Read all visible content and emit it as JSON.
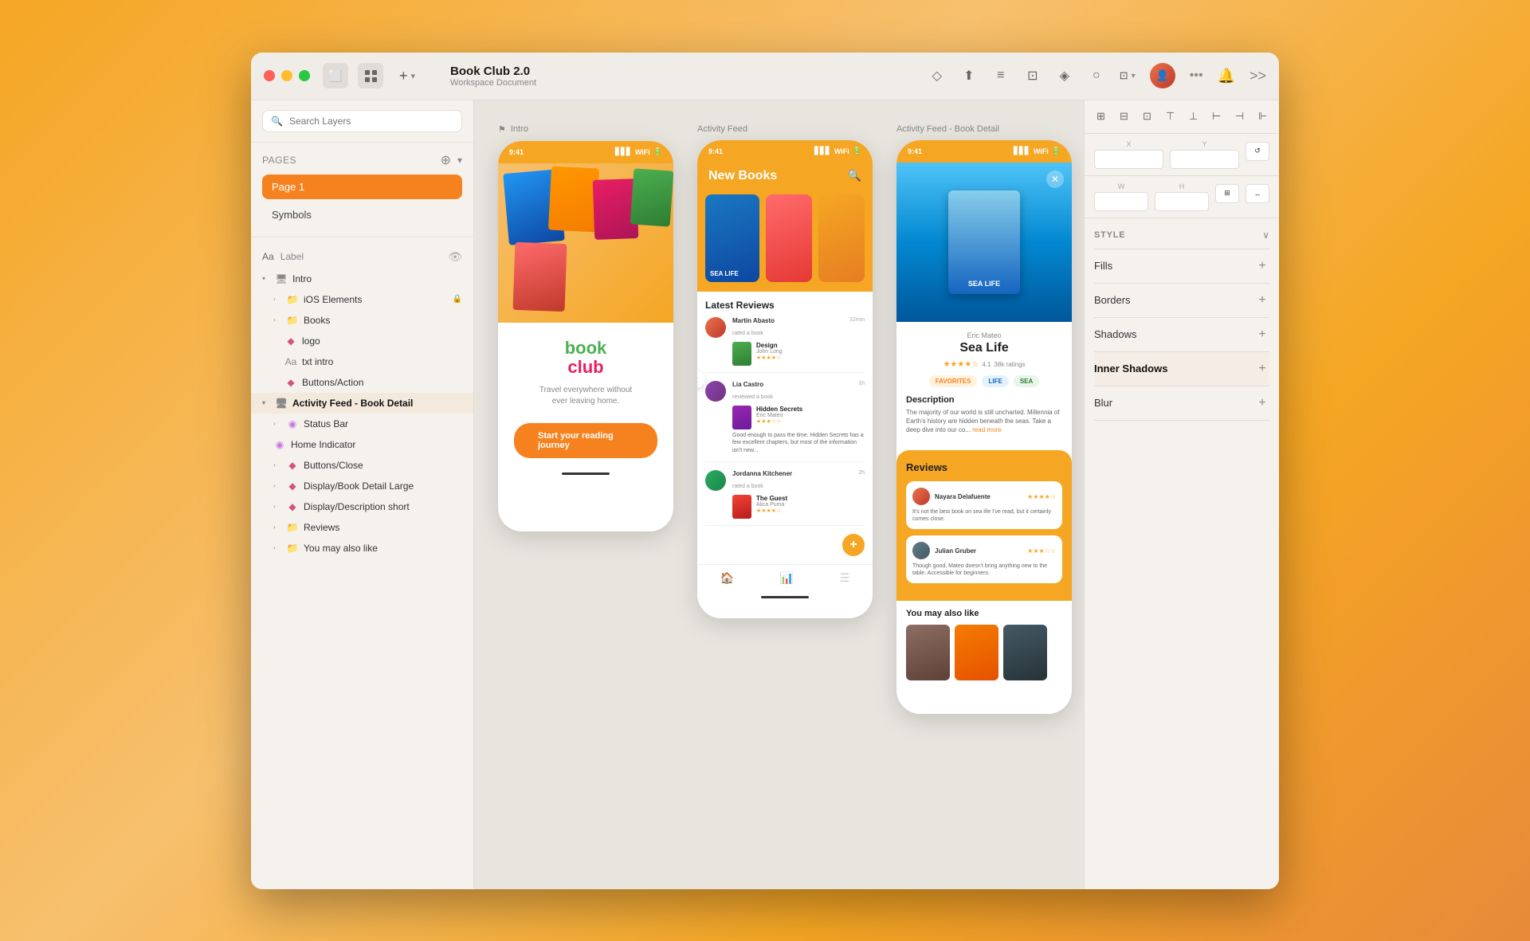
{
  "window": {
    "title": "Book Club 2.0",
    "subtitle": "Workspace Document"
  },
  "titlebar": {
    "add_label": "+",
    "actions": [
      {
        "icon": "diamond-icon",
        "label": "◇"
      },
      {
        "icon": "upload-icon",
        "label": "↑"
      },
      {
        "icon": "layers-icon",
        "label": "≡"
      },
      {
        "icon": "crop-icon",
        "label": "⊡"
      },
      {
        "icon": "component-icon",
        "label": "⊕"
      },
      {
        "icon": "mask-icon",
        "label": "○"
      }
    ]
  },
  "search": {
    "placeholder": "Search Layers"
  },
  "pages": {
    "label": "Pages",
    "items": [
      {
        "label": "Page 1",
        "active": true
      },
      {
        "label": "Symbols",
        "active": false
      }
    ]
  },
  "layers": {
    "label_text": "Label",
    "groups": [
      {
        "name": "Intro",
        "icon": "monitor-icon",
        "expanded": true,
        "indent": 0,
        "children": [
          {
            "name": "iOS Elements",
            "icon": "folder-icon",
            "indent": 1,
            "locked": true
          },
          {
            "name": "Books",
            "icon": "folder-icon",
            "indent": 1
          },
          {
            "name": "logo",
            "icon": "diamond-icon",
            "indent": 2
          },
          {
            "name": "txt intro",
            "icon": "text-icon",
            "indent": 2
          },
          {
            "name": "Buttons/Action",
            "icon": "diamond-icon",
            "indent": 2
          }
        ]
      },
      {
        "name": "Activity Feed - Book Detail",
        "icon": "monitor-icon",
        "expanded": true,
        "indent": 0,
        "active": true,
        "children": [
          {
            "name": "Status Bar",
            "icon": "component-icon",
            "indent": 1
          },
          {
            "name": "Home Indicator",
            "icon": "component-icon",
            "indent": 1
          },
          {
            "name": "Buttons/Close",
            "icon": "diamond-icon",
            "indent": 1
          },
          {
            "name": "Display/Book Detail Large",
            "icon": "diamond-icon",
            "indent": 1
          },
          {
            "name": "Display/Description short",
            "icon": "diamond-icon",
            "indent": 1
          },
          {
            "name": "Reviews",
            "icon": "folder-icon",
            "indent": 1
          },
          {
            "name": "You may also like",
            "icon": "folder-icon",
            "indent": 1
          }
        ]
      }
    ]
  },
  "canvas": {
    "frames": [
      {
        "label": "Intro",
        "type": "intro"
      },
      {
        "label": "Activity Feed",
        "type": "activity"
      },
      {
        "label": "Activity Feed - Book Detail",
        "type": "detail"
      }
    ]
  },
  "right_panel": {
    "style_label": "STYLE",
    "chevron": "∨",
    "rows": [
      {
        "label": "Fills",
        "plus": "+"
      },
      {
        "label": "Borders",
        "plus": "+"
      },
      {
        "label": "Shadows",
        "plus": "+"
      },
      {
        "label": "Inner Shadows",
        "plus": "+",
        "active": true
      },
      {
        "label": "Blur",
        "plus": "+"
      }
    ],
    "coords": {
      "x_label": "X",
      "y_label": "Y",
      "w_label": "W",
      "h_label": "H",
      "x_val": "",
      "y_val": "",
      "w_val": "",
      "h_val": ""
    }
  },
  "intro_screen": {
    "tagline_1": "Travel everywhere without",
    "tagline_2": "ever leaving home.",
    "cta": "Start your reading journey",
    "logo_book": "book",
    "logo_club": "club",
    "time": "9:41"
  },
  "activity_screen": {
    "time": "9:41",
    "title": "New Books",
    "section": "Latest Reviews",
    "reviews": [
      {
        "reviewer": "Martin Abasto",
        "action": "rated a book",
        "time": "32min",
        "book_title": "Design",
        "book_author": "John Long",
        "stars": 4
      },
      {
        "reviewer": "Lia Castro",
        "action": "reviewed a book",
        "time": "1h",
        "book_title": "Hidden Secrets",
        "book_author": "Eric Mateo",
        "stars": 3,
        "text": "Good enough to pass the time. Hidden Secrets has a few excellent chapters, but most of the information isn't new..."
      },
      {
        "reviewer": "Jordanna Kitchener",
        "action": "rated a book",
        "time": "2h",
        "book_title": "The Guest",
        "book_author": "Alica Puma",
        "stars": 4
      }
    ]
  },
  "detail_screen": {
    "time": "9:41",
    "author": "Eric Mateo",
    "title": "Sea Life",
    "rating": "4.1",
    "ratings_count": "38k ratings",
    "tags": [
      "FAVORITES",
      "LIFE",
      "SEA"
    ],
    "desc_title": "Description",
    "desc_text": "The majority of our world is still uncharted. Millennia of Earth's history are hidden beneath the seas. Take a deep dive into our co...",
    "read_more": "read more",
    "reviews_title": "Reviews",
    "reviewers": [
      {
        "name": "Nayara Delafuente",
        "stars": 4,
        "text": "It's not the best book on sea life I've read, but it certainly comes close."
      },
      {
        "name": "Julian Gruber",
        "stars": 3,
        "text": "Though good, Mateo doesn't bring anything new to the table. Accessible for beginners."
      }
    ],
    "you_may_title": "You may also like"
  }
}
